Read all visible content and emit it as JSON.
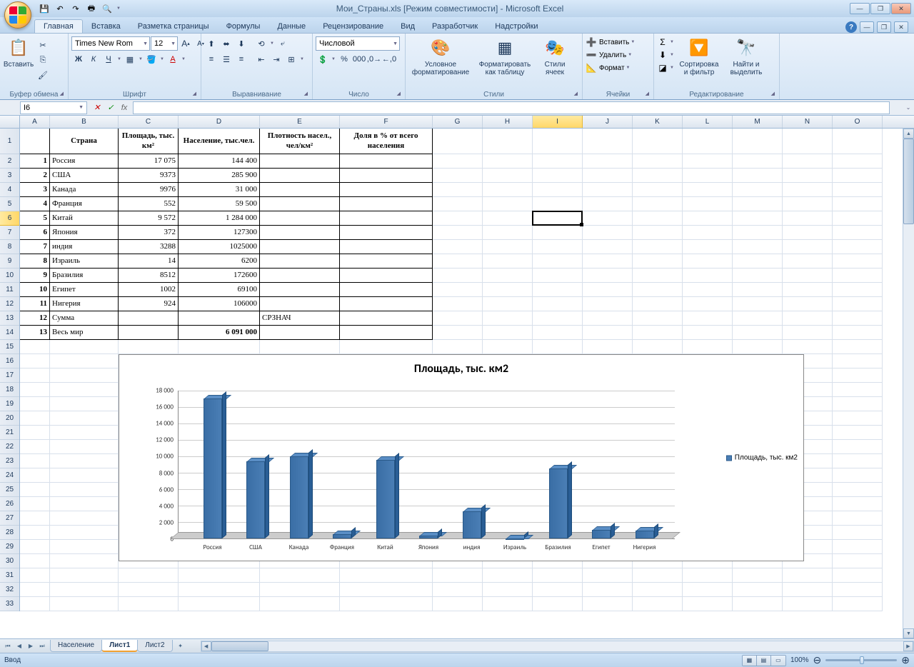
{
  "title": "Мои_Страны.xls  [Режим совместимости] - Microsoft Excel",
  "tabs": [
    "Главная",
    "Вставка",
    "Разметка страницы",
    "Формулы",
    "Данные",
    "Рецензирование",
    "Вид",
    "Разработчик",
    "Надстройки"
  ],
  "ribbon": {
    "clipboard": {
      "paste": "Вставить",
      "label": "Буфер обмена"
    },
    "font": {
      "name": "Times New Rom",
      "size": "12",
      "label": "Шрифт",
      "bold": "Ж",
      "italic": "К",
      "underline": "Ч"
    },
    "align": {
      "label": "Выравнивание"
    },
    "number": {
      "format": "Числовой",
      "label": "Число"
    },
    "styles": {
      "cond": "Условное форматирование",
      "table": "Форматировать как таблицу",
      "cell": "Стили ячеек",
      "label": "Стили"
    },
    "cells": {
      "insert": "Вставить",
      "delete": "Удалить",
      "format": "Формат",
      "label": "Ячейки"
    },
    "editing": {
      "sort": "Сортировка и фильтр",
      "find": "Найти и выделить",
      "label": "Редактирование"
    }
  },
  "namebox": "I6",
  "columns": {
    "A": 42,
    "B": 96,
    "C": 84,
    "D": 114,
    "E": 112,
    "F": 130,
    "G": 70,
    "H": 70,
    "I": 70,
    "J": 70,
    "K": 70,
    "L": 70,
    "M": 70,
    "N": 70,
    "O": 70
  },
  "headers": {
    "B": "Страна",
    "C": "Площадь, тыс. км²",
    "D": "Население, тыс.чел.",
    "E": "Плотность насел., чел/км²",
    "F": "Доля в % от всего населения"
  },
  "rows": [
    {
      "n": "1",
      "country": "Россия",
      "area": "17 075",
      "pop": "144 400"
    },
    {
      "n": "2",
      "country": "США",
      "area": "9373",
      "pop": "285 900"
    },
    {
      "n": "3",
      "country": "Канада",
      "area": "9976",
      "pop": "31 000"
    },
    {
      "n": "4",
      "country": "Франция",
      "area": "552",
      "pop": "59 500"
    },
    {
      "n": "5",
      "country": "Китай",
      "area": "9 572",
      "pop": "1 284 000"
    },
    {
      "n": "6",
      "country": "Япония",
      "area": "372",
      "pop": "127300"
    },
    {
      "n": "7",
      "country": "индия",
      "area": "3288",
      "pop": "1025000"
    },
    {
      "n": "8",
      "country": "Израиль",
      "area": "14",
      "pop": "6200"
    },
    {
      "n": "9",
      "country": "Бразилия",
      "area": "8512",
      "pop": "172600"
    },
    {
      "n": "10",
      "country": "Египет",
      "area": "1002",
      "pop": "69100"
    },
    {
      "n": "11",
      "country": "Нигерия",
      "area": "924",
      "pop": "106000"
    }
  ],
  "sumrow": {
    "n": "12",
    "label": "Сумма",
    "e": "СРЗНАЧ"
  },
  "worldrow": {
    "n": "13",
    "label": "Весь мир",
    "pop": "6 091 000"
  },
  "chart_data": {
    "type": "bar",
    "title": "Площадь, тыс. км2",
    "categories": [
      "Россия",
      "США",
      "Канада",
      "Франция",
      "Китай",
      "Япония",
      "индия",
      "Израиль",
      "Бразилия",
      "Египет",
      "Нигерия"
    ],
    "values": [
      17075,
      9373,
      9976,
      552,
      9572,
      372,
      3288,
      14,
      8512,
      1002,
      924
    ],
    "ylim": [
      0,
      18000
    ],
    "yticks": [
      "0",
      "2 000",
      "4 000",
      "6 000",
      "8 000",
      "10 000",
      "12 000",
      "14 000",
      "16 000",
      "18 000"
    ],
    "legend": "Площадь, тыс. км2"
  },
  "sheets": [
    "Население",
    "Лист1",
    "Лист2"
  ],
  "active_sheet": 1,
  "status": "Ввод",
  "zoom": "100%"
}
